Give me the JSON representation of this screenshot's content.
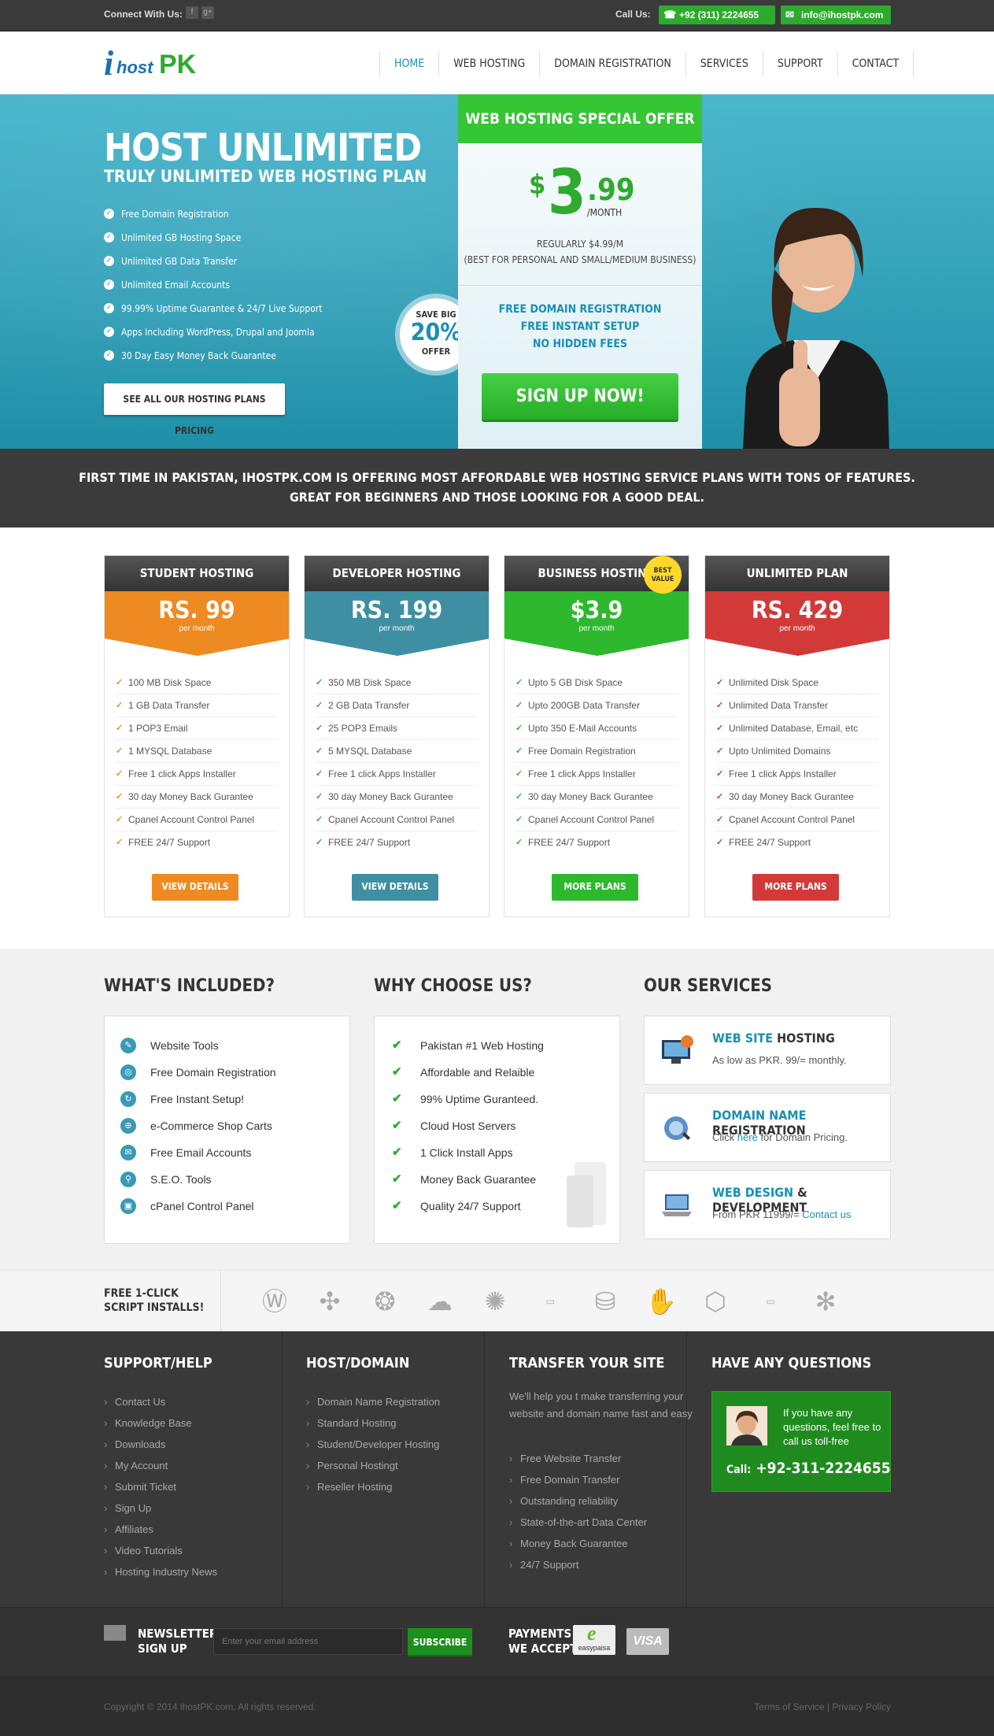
{
  "topbar": {
    "connect": "Connect With Us:",
    "social": [
      "f",
      "g+"
    ],
    "call_label": "Call Us:",
    "phone": "+92 (311) 2224655",
    "email": "info@ihostpk.com"
  },
  "header": {
    "logo_i": "i",
    "logo_host": "host",
    "logo_pk": "PK",
    "nav": [
      "HOME",
      "WEB HOSTING",
      "DOMAIN REGISTRATION",
      "SERVICES",
      "SUPPORT",
      "CONTACT"
    ]
  },
  "hero": {
    "title": "HOST UNLIMITED",
    "subtitle": "TRULY UNLIMITED WEB HOSTING PLAN",
    "features": [
      "Free Domain Registration",
      "Unlimited GB Hosting Space",
      "Unlimited GB Data Transfer",
      "Unlimited Email Accounts",
      "99.99% Uptime Guarantee & 24/7 Live Support",
      "Apps Including WordPress, Drupal and Joomla",
      "30 Day Easy Money Back Guarantee"
    ],
    "see_all": "SEE ALL OUR HOSTING PLANS PRICING",
    "save_line1": "SAVE BIG",
    "save_pct": "20%",
    "save_line3": "OFFER"
  },
  "offer": {
    "heading": "WEB HOSTING SPECIAL OFFER",
    "currency": "$",
    "price_int": "3",
    "price_dec": ".99",
    "per": "/MONTH",
    "regular": "REGULARLY $4.99/M",
    "best_for": "(BEST FOR PERSONAL AND SMALL/MEDIUM BUSINESS)",
    "perks": [
      "FREE DOMAIN REGISTRATION",
      "FREE INSTANT SETUP",
      "NO HIDDEN FEES"
    ],
    "signup": "SIGN UP NOW!"
  },
  "banner": {
    "line1": "FIRST TIME IN PAKISTAN, IHOSTPK.COM IS OFFERING MOST AFFORDABLE WEB HOSTING SERVICE PLANS WITH TONS OF FEATURES.",
    "line2": "GREAT FOR BEGINNERS AND THOSE LOOKING FOR A GOOD DEAL."
  },
  "plans": [
    {
      "name": "STUDENT HOSTING",
      "price": "RS. 99",
      "per": "per month",
      "color": "#ee8a22",
      "features": [
        "100 MB Disk Space",
        "1 GB Data Transfer",
        "1 POP3 Email",
        "1 MYSQL Database",
        "Free 1 click Apps Installer",
        "30 day Money Back Gurantee",
        "Cpanel Account Control Panel",
        "FREE 24/7 Support"
      ],
      "button": "VIEW DETAILS"
    },
    {
      "name": "DEVELOPER HOSTING",
      "price": "RS. 199",
      "per": "per month",
      "color": "#3f8fa3",
      "features": [
        "350 MB Disk Space",
        "2 GB Data Transfer",
        "25 POP3 Emails",
        "5 MYSQL Database",
        "Free 1 click Apps Installer",
        "30 day Money Back Gurantee",
        "Cpanel Account Control Panel",
        "FREE 24/7 Support"
      ],
      "button": "VIEW DETAILS"
    },
    {
      "name": "BUSINESS HOSTING",
      "price": "$3.9",
      "per": "per month",
      "color": "#2eb82e",
      "features": [
        "Upto 5 GB Disk Space",
        "Upto 200GB Data Transfer",
        "Upto 350 E-Mail Accounts",
        "Free Domain Registration",
        "Free 1 click Apps Installer",
        "30 day Money Back Gurantee",
        "Cpanel Account Control Panel",
        "FREE 24/7 Support"
      ],
      "button": "MORE PLANS"
    },
    {
      "name": "UNLIMITED PLAN",
      "price": "RS. 429",
      "per": "per month",
      "color": "#d23a3a",
      "features": [
        "Unlimited Disk Space",
        "Unlimited Data Transfer",
        "Unlimited Database, Email, etc",
        "Upto Unlimited Domains",
        "Free 1 click Apps Installer",
        "30 day Money Back Gurantee",
        "Cpanel Account Control Panel",
        "FREE 24/7 Support"
      ],
      "button": "MORE PLANS"
    }
  ],
  "best_value": "BEST VALUE",
  "included": {
    "title": "WHAT'S INCLUDED?",
    "items": [
      "Website Tools",
      "Free Domain Registration",
      "Free Instant Setup!",
      "e-Commerce Shop Carts",
      "Free Email Accounts",
      "S.E.O. Tools",
      "cPanel Control Panel"
    ]
  },
  "why": {
    "title": "WHY CHOOSE US?",
    "items": [
      "Pakistan #1 Web Hosting",
      "Affordable and Relaible",
      "99% Uptime Guranteed.",
      "Cloud Host Servers",
      "1 Click Install Apps",
      "Money Back Guarantee",
      "Quality 24/7 Support"
    ]
  },
  "services": {
    "title": "OUR SERVICES",
    "items": [
      {
        "hl": "WEB SITE",
        "rest": " HOSTING",
        "desc": "As low as PKR. 99/= monthly."
      },
      {
        "hl": "DOMAIN NAME",
        "rest": " REGISTRATION",
        "pre": "Click ",
        "link": "here",
        "post": " for Domain Pricing."
      },
      {
        "hl": "WEB DESIGN",
        "rest": " & DEVELOPMENT",
        "pre": "From PKR 11999/= ",
        "link": "Contact us",
        "post": ""
      }
    ]
  },
  "scripts": {
    "label1": "FREE 1-CLICK",
    "label2": "SCRIPT INSTALLS!",
    "icons": [
      "wordpress-icon",
      "joomla-icon",
      "drupal-icon",
      "cloud-icon",
      "swirl-icon",
      "phpbb-icon",
      "prestashop-icon",
      "hand-icon",
      "magento-icon",
      "phpbb2-icon",
      "flower-icon"
    ]
  },
  "footer": {
    "support": {
      "title": "SUPPORT/HELP",
      "links": [
        "Contact Us",
        "Knowledge Base",
        "Downloads",
        "My Account",
        "Submit Ticket",
        "Sign Up",
        "Affiliates",
        "Video Tutorials",
        "Hosting Industry News"
      ]
    },
    "host": {
      "title": "HOST/DOMAIN",
      "links": [
        "Domain Name Registration",
        "Standard Hosting",
        "Student/Developer Hosting",
        "Personal Hostingt",
        "Reseller Hosting"
      ]
    },
    "transfer": {
      "title": "TRANSFER YOUR SITE",
      "text": "We'll help you t make transferring your website and domain name fast and easy",
      "links": [
        "Free Website Transfer",
        "Free Domain Transfer",
        "Outstanding reliability",
        "State-of-the-art Data Center",
        "Money Back Guarantee",
        "24/7 Support"
      ]
    },
    "questions": {
      "title": "HAVE ANY QUESTIONS",
      "text": "If you have any questions, feel free to call us toll-free",
      "call_label": "Call:",
      "phone": "+92-311-2224655"
    }
  },
  "newsletter": {
    "label1": "NEWSLETTER",
    "label2": "SIGN UP",
    "placeholder": "Enter your email address",
    "button": "SUBSCRIBE",
    "pay1": "PAYMENTS",
    "pay2": "WE ACCEPT",
    "easypaisa": "easypaisa",
    "visa": "VISA"
  },
  "copyright": {
    "text": "Copyright © 2014 ihostPK.com. All rights reserved.",
    "links": "Terms of Service | Privacy Policy"
  }
}
